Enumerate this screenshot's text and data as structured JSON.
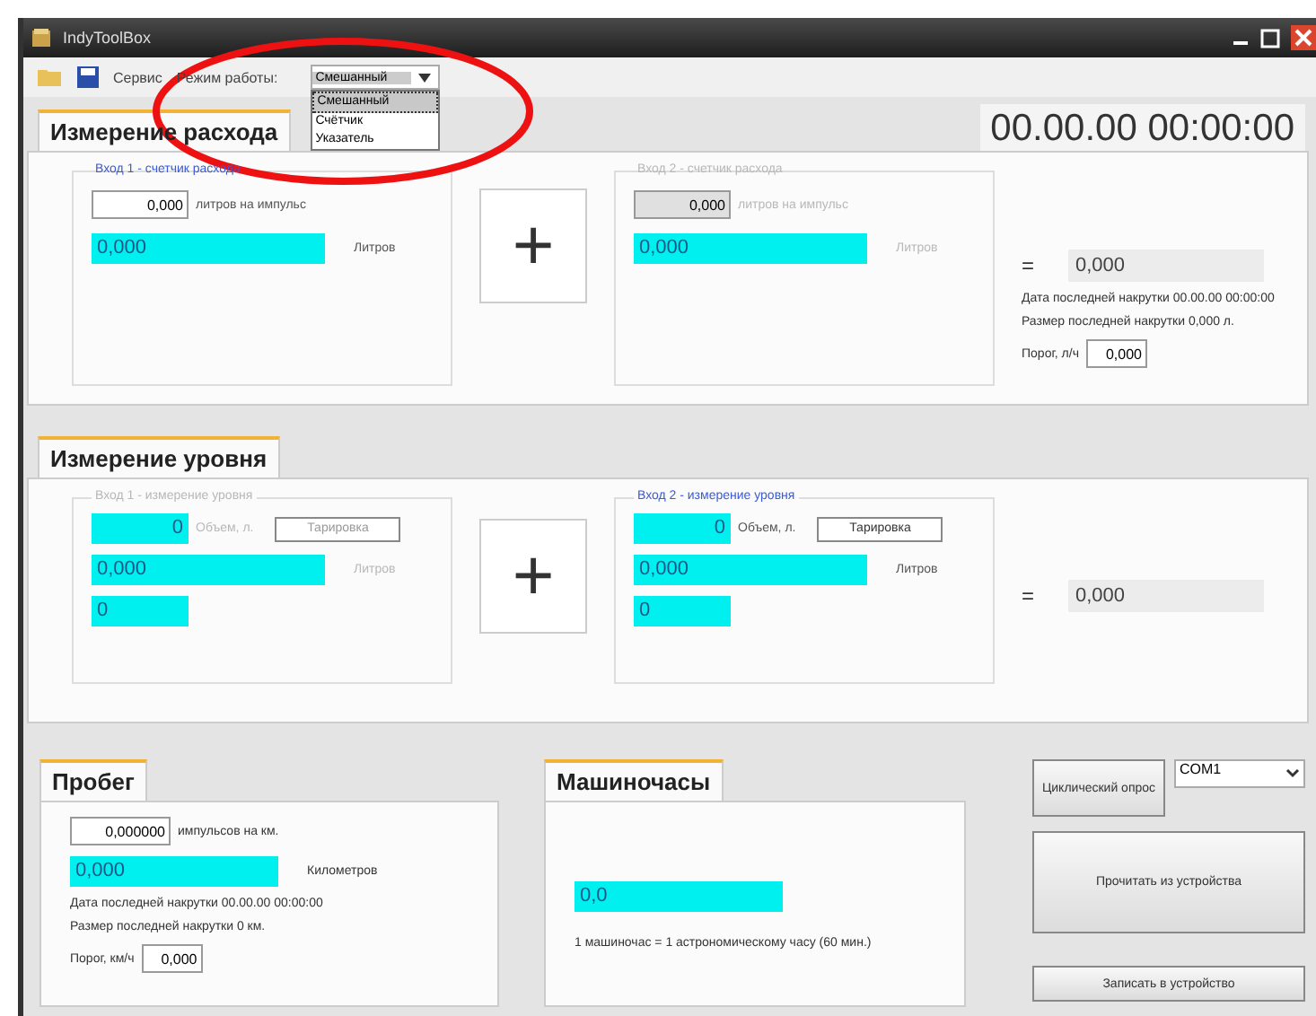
{
  "window": {
    "title": "IndyToolBox"
  },
  "toolbar": {
    "menu": "Сервис",
    "mode_label": "Режим работы:",
    "mode_value": "Смешанный",
    "expanded": true,
    "mode_options": [
      {
        "label": "Смешанный",
        "selected": true
      },
      {
        "label": "Счётчик",
        "selected": false
      },
      {
        "label": "Указатель",
        "selected": false
      }
    ]
  },
  "clock": "00.00.00 00:00:00",
  "flow": {
    "tab": "Измерение расхода",
    "plus": "+",
    "equals": "=",
    "total": "0,000",
    "inputs": [
      {
        "title": "Вход 1 - счетчик расхода",
        "disabled": false,
        "factor": "0,000",
        "factor_unit": "литров на импульс",
        "value": "0,000",
        "unit": "Литров"
      },
      {
        "title": "Вход 2 - счетчик расхода",
        "disabled": true,
        "factor": "0,000",
        "factor_unit": "литров на импульс",
        "value": "0,000",
        "unit": "Литров"
      }
    ],
    "last_date": "Дата последней накрутки 00.00.00 00:00:00",
    "last_size": "Размер последней накрутки 0,000 л.",
    "threshold_label": "Порог, л/ч",
    "threshold": "0,000"
  },
  "level": {
    "tab": "Измерение уровня",
    "plus": "+",
    "equals": "=",
    "total": "0,000",
    "inputs": [
      {
        "title": "Вход 1 - измерение уровня",
        "disabled": true,
        "volume": "0",
        "volume_unit": "Объем, л.",
        "button": "Тарировка",
        "value": "0,000",
        "unit": "Литров",
        "count": "0"
      },
      {
        "title": "Вход 2 - измерение уровня",
        "disabled": false,
        "volume": "0",
        "volume_unit": "Объем, л.",
        "button": "Тарировка",
        "value": "0,000",
        "unit": "Литров",
        "count": "0"
      }
    ]
  },
  "mileage": {
    "tab": "Пробег",
    "factor": "0,000000",
    "factor_unit": "импульсов на км.",
    "value": "0,000",
    "unit": "Километров",
    "last_date": "Дата последней накрутки 00.00.00 00:00:00",
    "last_size": "Размер последней накрутки 0 км.",
    "threshold_label": "Порог, км/ч",
    "threshold": "0,000"
  },
  "hours": {
    "tab": "Машиночасы",
    "value": "0,0",
    "note": "1 машиночас = 1 астрономическому часу (60 мин.)"
  },
  "controls": {
    "cyclic": "Циклический опрос",
    "port": "COM1",
    "read": "Прочитать из устройства",
    "write": "Записать в устройство"
  },
  "annotation": {
    "kind": "ellipse",
    "color": "#ee1111"
  }
}
